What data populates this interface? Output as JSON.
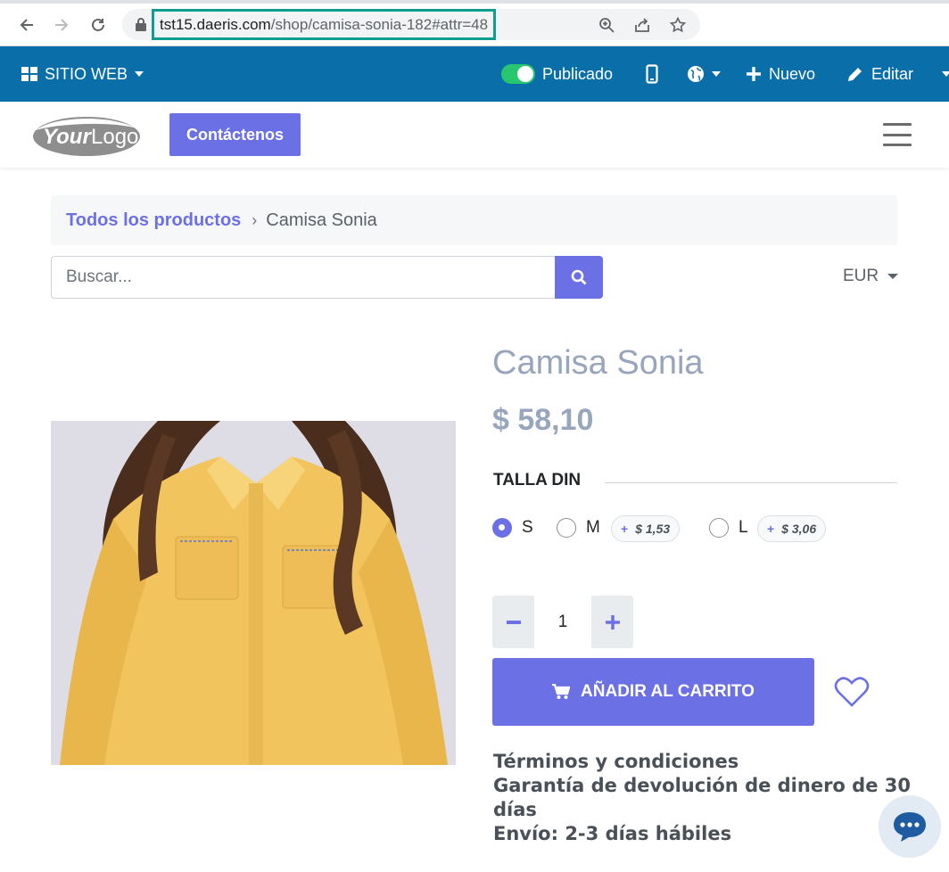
{
  "browser": {
    "url_host": "tst15.daeris.com",
    "url_path": "/shop/camisa-sonia-182#attr=48"
  },
  "admin_bar": {
    "site_menu": "SITIO WEB",
    "published_label": "Publicado",
    "new_label": "Nuevo",
    "edit_label": "Editar"
  },
  "header": {
    "logo_text": "YourLogo",
    "contact_button": "Contáctenos"
  },
  "breadcrumb": {
    "link": "Todos los productos",
    "separator": "›",
    "current": "Camisa Sonia"
  },
  "search": {
    "placeholder": "Buscar...",
    "currency": "EUR"
  },
  "product": {
    "name": "Camisa Sonia",
    "price": "$ 58,10",
    "attribute_label": "TALLA DIN",
    "options": [
      {
        "label": "S",
        "extra": "",
        "selected": true
      },
      {
        "label": "M",
        "extra": "$ 1,53",
        "selected": false
      },
      {
        "label": "L",
        "extra": "$ 3,06",
        "selected": false
      }
    ],
    "quantity": "1",
    "add_to_cart": "AÑADIR AL CARRITO",
    "terms": [
      "Términos y condiciones",
      "Garantía de devolución de dinero de 30 días",
      "Envío: 2-3 días hábiles"
    ]
  },
  "colors": {
    "accent": "#6c70e5",
    "admin_bar": "#0a6fa9",
    "toggle_on": "#28c76f",
    "title_gray": "#97a6bc"
  }
}
